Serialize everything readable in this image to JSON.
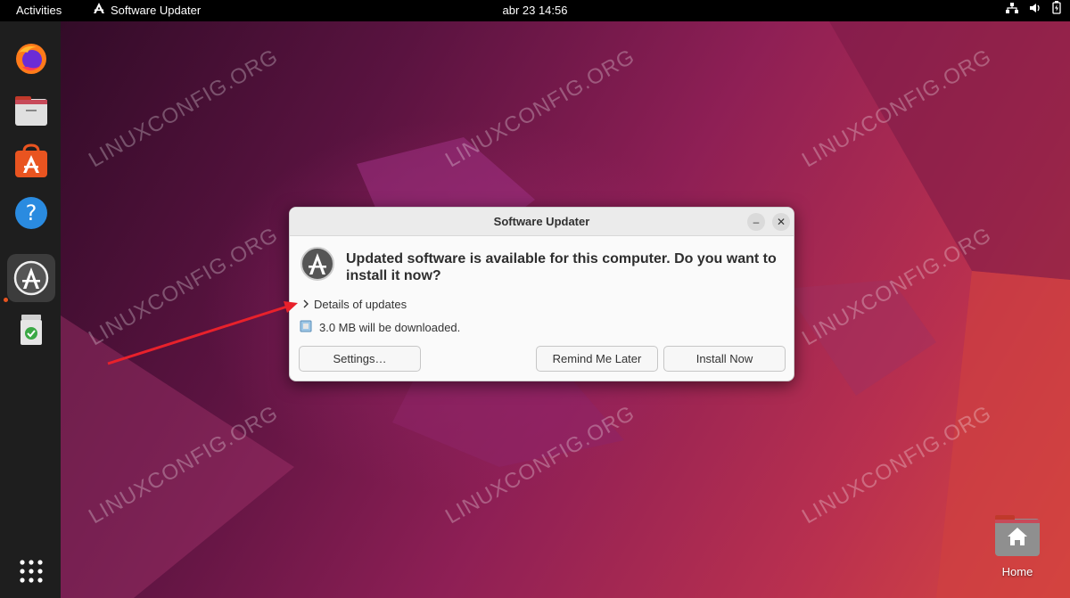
{
  "topbar": {
    "activities": "Activities",
    "app_name": "Software Updater",
    "clock": "abr 23  14:56",
    "tray_icons": [
      "network-icon",
      "volume-icon",
      "battery-icon"
    ]
  },
  "dock": {
    "items": [
      "firefox-icon",
      "files-icon",
      "software-center-icon",
      "help-icon",
      "software-updater-icon",
      "trash-icon"
    ],
    "show_apps": "apps-grid-icon",
    "accent": "#e95420"
  },
  "watermark": "LINUXCONFIG.ORG",
  "desktop": {
    "home_label": "Home"
  },
  "dialog": {
    "title": "Software Updater",
    "message": "Updated software is available for this computer. Do you want to install it now?",
    "details_label": "Details of updates",
    "download_size": "3.0 MB will be downloaded.",
    "buttons": {
      "settings": "Settings…",
      "remind": "Remind Me Later",
      "install": "Install Now"
    }
  },
  "annotation_color": "#e8212b"
}
